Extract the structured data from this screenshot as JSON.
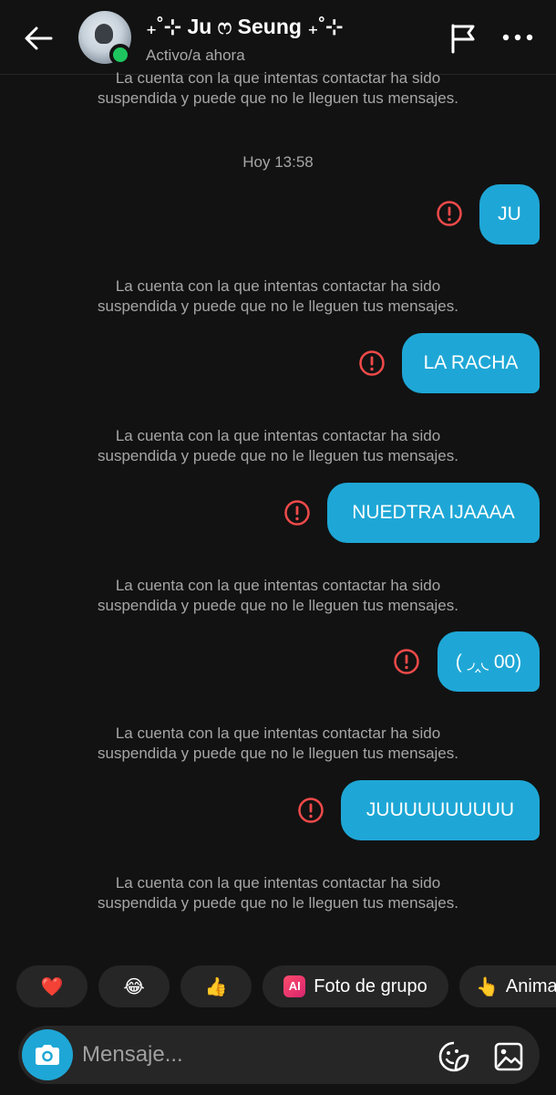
{
  "header": {
    "title": "₊˚⊹ Ju ෆ Seung ₊˚⊹",
    "status": "Activo/a ahora",
    "back_icon": "arrow-left-icon",
    "flag_icon": "flag-icon",
    "more_icon": "more-horizontal-icon"
  },
  "conversation": {
    "timestamp": "Hoy 13:58",
    "notice_line1": "La cuenta con la que intentas contactar ha sido",
    "notice_line2": "suspendida y puede que no le lleguen tus mensajes.",
    "messages": [
      {
        "text": "JU"
      },
      {
        "text": "LA RACHA"
      },
      {
        "text": "NUEDTRA IJAAAA"
      },
      {
        "text": "( ◞‸◟ 00)"
      },
      {
        "text": "JUUUUUUUUUU"
      }
    ],
    "error_color": "#f04a4a",
    "bubble_color": "#1ea7d6"
  },
  "quick_replies": {
    "heart": "❤️",
    "laugh": "😂",
    "thumbs": "👍",
    "ai_badge": "AI",
    "group_photo": "Foto de grupo",
    "animate_emoji": "👆",
    "animate": "Anima"
  },
  "composer": {
    "placeholder": "Mensaje...",
    "camera_icon": "camera-icon",
    "sticker_icon": "sticker-icon",
    "gallery_icon": "gallery-icon"
  }
}
